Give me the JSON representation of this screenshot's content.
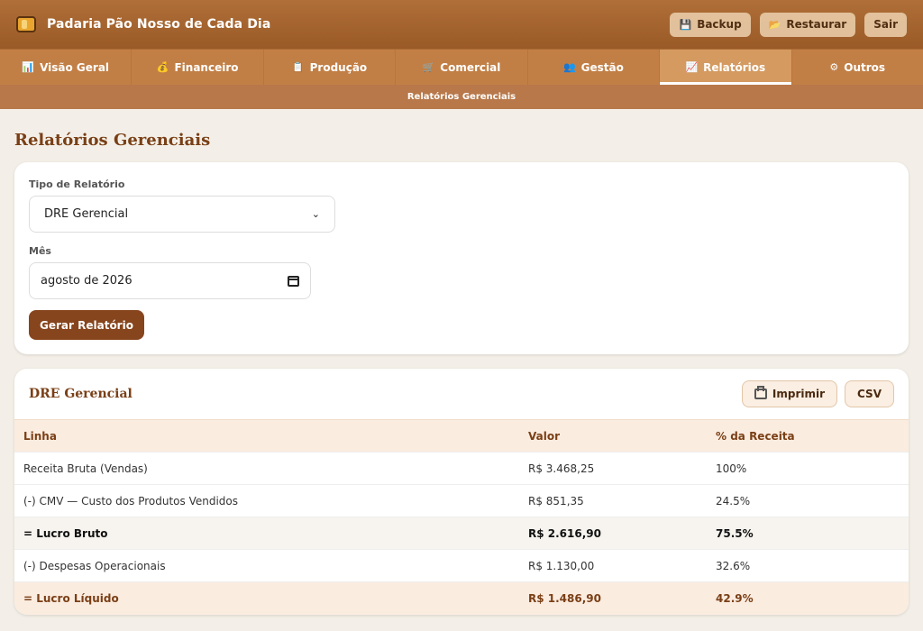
{
  "app": {
    "title": "Padaria Pão Nosso de Cada Dia"
  },
  "header_actions": [
    {
      "label": "Backup",
      "icon": "floppy-icon"
    },
    {
      "label": "Restaurar",
      "icon": "folder-icon"
    },
    {
      "label": "Sair"
    }
  ],
  "tabs": [
    {
      "label": "Visão Geral",
      "icon": "chart-icon",
      "glyph": "📊"
    },
    {
      "label": "Financeiro",
      "icon": "money-bag-icon",
      "glyph": "💰"
    },
    {
      "label": "Produção",
      "icon": "clipboard-icon",
      "glyph": "📋"
    },
    {
      "label": "Comercial",
      "icon": "cart-icon",
      "glyph": "🛒"
    },
    {
      "label": "Gestão",
      "icon": "people-icon",
      "glyph": "👥"
    },
    {
      "label": "Relatórios",
      "icon": "trend-icon",
      "glyph": "📈",
      "active": true
    },
    {
      "label": "Outros",
      "icon": "gear-icon",
      "glyph": "⚙"
    }
  ],
  "subnav": {
    "label": "Relatórios Gerenciais"
  },
  "page": {
    "title": "Relatórios Gerenciais"
  },
  "form": {
    "type_label": "Tipo de Relatório",
    "type_value": "DRE Gerencial",
    "month_label": "Mês",
    "month_value": "agosto de 2026",
    "submit_label": "Gerar Relatório"
  },
  "report": {
    "title": "DRE Gerencial",
    "print_label": "Imprimir",
    "csv_label": "CSV",
    "columns": [
      "Linha",
      "Valor",
      "% da Receita"
    ],
    "rows": [
      {
        "line": "Receita Bruta (Vendas)",
        "value": "R$ 3.468,25",
        "pct": "100%",
        "style": "normal"
      },
      {
        "line": "(-) CMV — Custo dos Produtos Vendidos",
        "value": "R$ 851,35",
        "pct": "24.5%",
        "style": "normal"
      },
      {
        "line": "= Lucro Bruto",
        "value": "R$ 2.616,90",
        "pct": "75.5%",
        "style": "bold"
      },
      {
        "line": "(-) Despesas Operacionais",
        "value": "R$ 1.130,00",
        "pct": "32.6%",
        "style": "normal"
      },
      {
        "line": "= Lucro Líquido",
        "value": "R$ 1.486,90",
        "pct": "42.9%",
        "style": "net"
      }
    ]
  },
  "colors": {
    "brand": "#9a5a27",
    "accent": "#87451d",
    "title": "#7a3f16"
  }
}
